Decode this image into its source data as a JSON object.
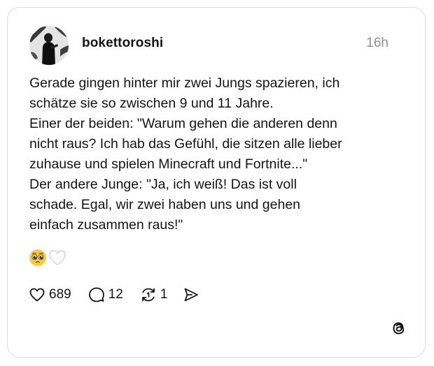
{
  "post": {
    "username": "bokettoroshi",
    "timestamp": "16h",
    "text_lines": [
      "Gerade gingen hinter mir zwei Jungs spazieren, ich",
      "schätze sie so zwischen 9 und 11 Jahre.",
      "Einer der beiden: \"Warum gehen die anderen denn",
      "nicht raus? Ich hab das Gefühl, die sitzen alle lieber",
      "zuhause und spielen Minecraft und Fortnite...\"",
      "Der andere Junge: \"Ja, ich weiß! Das ist voll",
      "schade. Egal, wir zwei haben uns und gehen",
      "einfach zusammen raus!\""
    ],
    "emojis": [
      "pleading-face-emoji",
      "white-heart-emoji"
    ]
  },
  "actions": {
    "like_count": "689",
    "reply_count": "12",
    "repost_count": "1",
    "icons": [
      "heart-icon",
      "comment-icon",
      "repost-icon",
      "share-icon"
    ]
  },
  "branding": {
    "logo": "threads-logo-icon"
  },
  "colors": {
    "text": "#141414",
    "muted": "#8e8e8e",
    "border": "#dcdcdc",
    "emoji_face": "#f7c948",
    "heart_fill": "#ffffff"
  }
}
